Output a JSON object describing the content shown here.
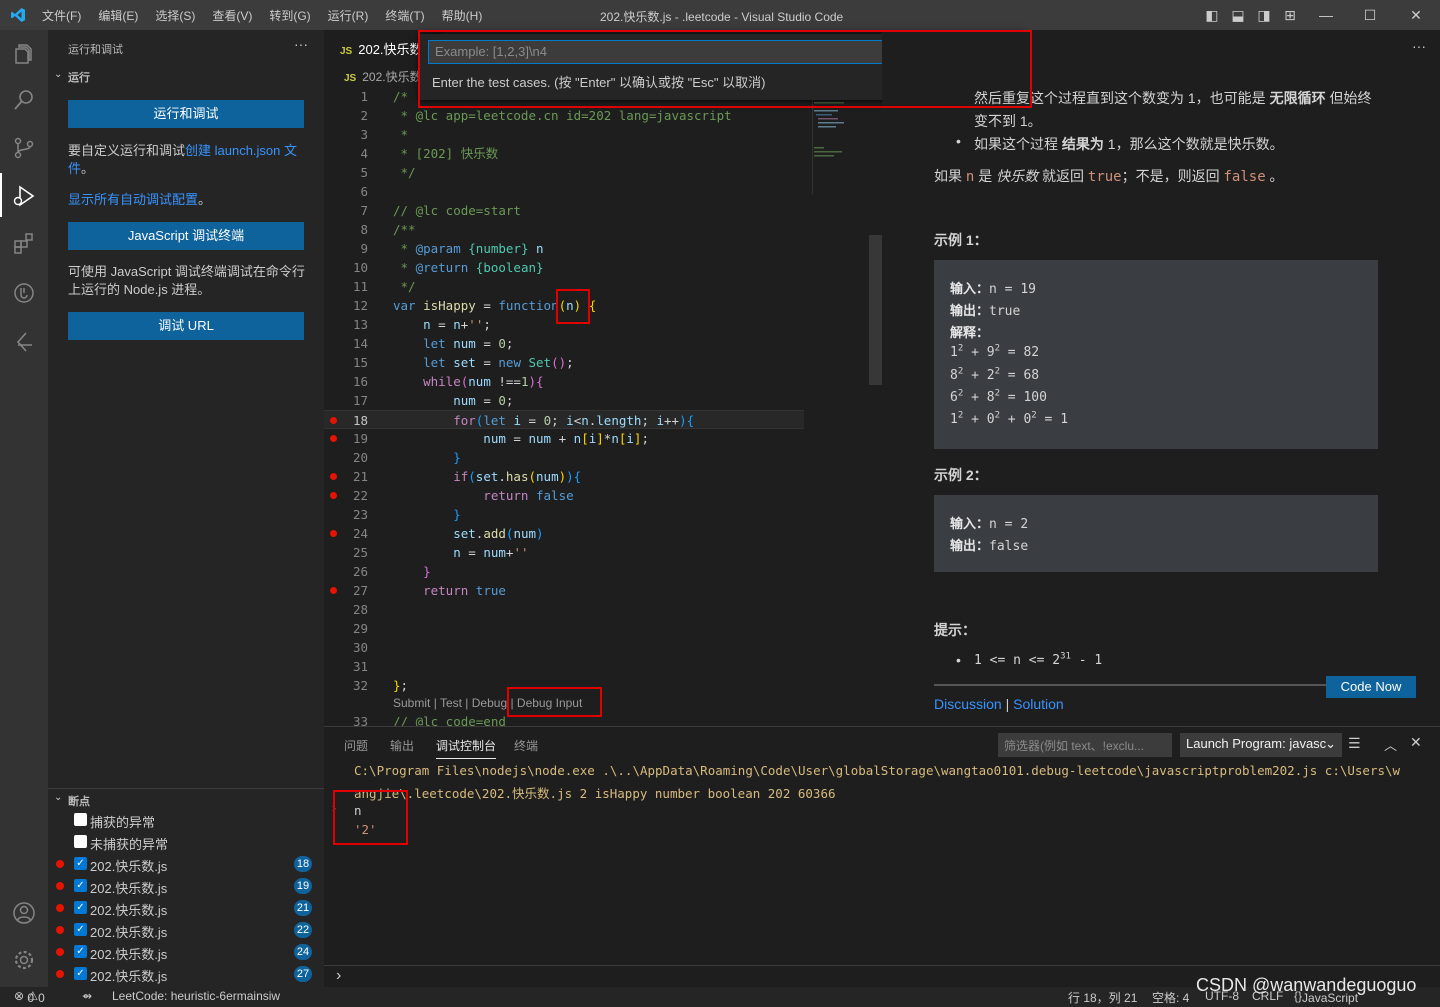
{
  "titlebar": {
    "menu": [
      "文件(F)",
      "编辑(E)",
      "选择(S)",
      "查看(V)",
      "转到(G)",
      "运行(R)",
      "终端(T)",
      "帮助(H)"
    ],
    "title": "202.快乐数.js - .leetcode - Visual Studio Code"
  },
  "sidebar": {
    "header": "运行和调试",
    "section": "运行",
    "run_debug_button": "运行和调试",
    "customize_text": "要自定义运行和调试",
    "create_launch_link": "创建 launch.json 文件",
    "period": "。",
    "show_all_link": "显示所有自动调试配置",
    "js_terminal_button": "JavaScript 调试终端",
    "js_terminal_desc": "可使用 JavaScript 调试终端调试在命令行上运行的 Node.js 进程。",
    "debug_url_button": "调试 URL",
    "breakpoints_section": "断点",
    "caught_exceptions": "捕获的异常",
    "uncaught_exceptions": "未捕获的异常",
    "breakpoints": [
      {
        "file": "202.快乐数.js",
        "line": "18"
      },
      {
        "file": "202.快乐数.js",
        "line": "19"
      },
      {
        "file": "202.快乐数.js",
        "line": "21"
      },
      {
        "file": "202.快乐数.js",
        "line": "22"
      },
      {
        "file": "202.快乐数.js",
        "line": "24"
      },
      {
        "file": "202.快乐数.js",
        "line": "27"
      }
    ]
  },
  "editor": {
    "tab_label": "202.快乐数",
    "breadcrumb": "202.快乐数",
    "js_badge": "JS",
    "codelens": {
      "submit": "Submit",
      "test": "Test",
      "debug": "Debug",
      "debug_input": "Debug Input",
      "sep": " | "
    },
    "line_numbers": [
      "1",
      "2",
      "3",
      "4",
      "5",
      "6",
      "7",
      "8",
      "9",
      "10",
      "11",
      "12",
      "13",
      "14",
      "15",
      "16",
      "17",
      "18",
      "19",
      "20",
      "21",
      "22",
      "23",
      "24",
      "25",
      "26",
      "27",
      "28",
      "29",
      "30",
      "31",
      "32",
      "33"
    ]
  },
  "quick_input": {
    "placeholder": "Example: [1,2,3]\\n4",
    "message": "Enter the test cases. (按 \"Enter\" 以确认或按 \"Esc\" 以取消)"
  },
  "webview": {
    "top_line1": "然后重复这个过程直到这个数变为 1，也可能是 ",
    "top_bold1": "无限循环",
    "top_line1b": " 但始终",
    "top_line2": "变不到 1。",
    "bullet2_a": "如果这个过程 ",
    "bullet2_b": "结果为",
    "bullet2_c": " 1，那么这个数就是快乐数。",
    "desc_a": "如果 ",
    "desc_n": "n",
    "desc_b": " 是 ",
    "desc_c": "快乐数",
    "desc_d": " 就返回 ",
    "desc_true": "true",
    "desc_e": "；不是，则返回 ",
    "desc_false": "false",
    "desc_f": " 。",
    "example1_title": "示例 1：",
    "ex1_input_label": "输入：",
    "ex1_input": "n = 19",
    "ex1_output_label": "输出：",
    "ex1_output": "true",
    "ex1_explain_label": "解释：",
    "example2_title": "示例 2：",
    "ex2_input": "n = 2",
    "ex2_output": "false",
    "hint_title": "提示：",
    "code_now": "Code Now",
    "discussion": "Discussion",
    "solution": "Solution",
    "sep": " | "
  },
  "panel": {
    "tabs": [
      "问题",
      "输出",
      "调试控制台",
      "终端"
    ],
    "filter_placeholder": "筛选器(例如 text、!exclu...",
    "launch_config": "Launch Program: javasc",
    "console_cmd1": "C:\\Program Files\\nodejs\\node.exe .\\..\\AppData\\Roaming\\Code\\User\\globalStorage\\wangtao0101.debug-leetcode\\javascriptproblem202.js c:\\Users\\w",
    "console_cmd2": "angjie\\.leetcode\\202.快乐数.js 2 isHappy number boolean 202 60366",
    "console_var": "n",
    "console_val": "'2'",
    "prompt": "›"
  },
  "statusbar": {
    "errors": "0",
    "warnings": "0",
    "leetcode": "LeetCode: heuristic-6ermainsiw",
    "position": "行 18，列 21",
    "spaces": "空格: 4",
    "encoding": "UTF-8",
    "eol": "CRLF",
    "language": "JavaScript",
    "watermark": "CSDN @wanwandeguoguo"
  },
  "colors": {
    "accent": "#0e639c",
    "breakpoint": "#e51400",
    "annotation": "#e00000"
  }
}
